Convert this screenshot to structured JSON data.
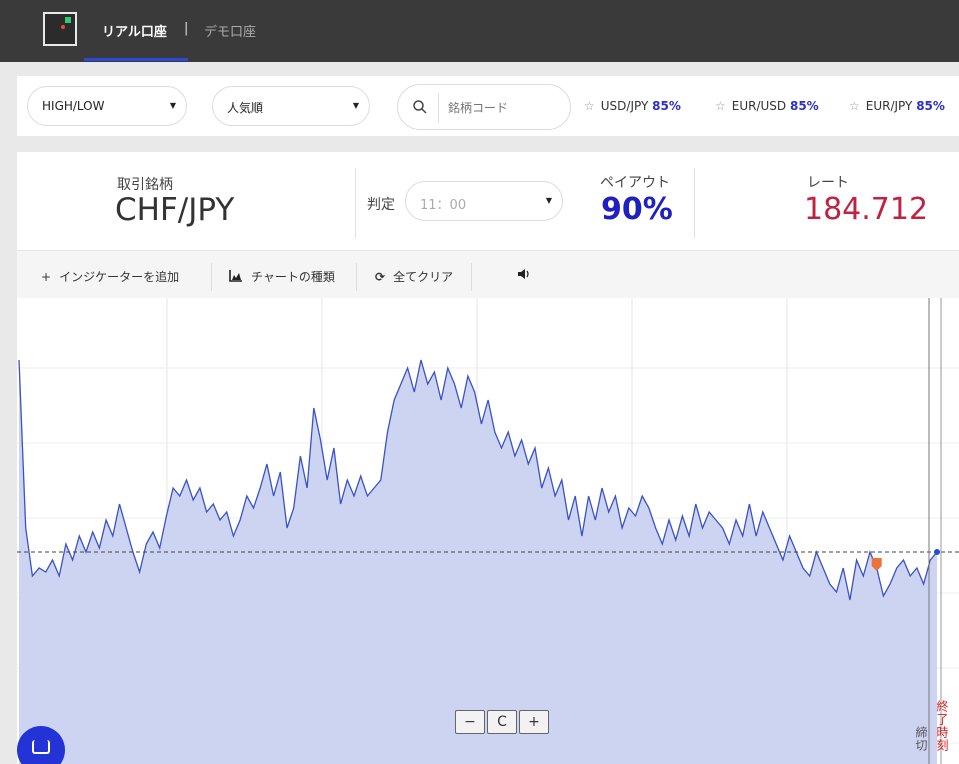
{
  "header": {
    "logo_icon": "app-logo-icon",
    "tabs": [
      {
        "label": "リアル口座",
        "active": true
      },
      {
        "label": "デモ口座",
        "active": false
      }
    ],
    "separator": "|",
    "accent_color": "#2a4bd8"
  },
  "filters": {
    "type_select": "HIGH/LOW",
    "sort_select": "人気順",
    "search_placeholder": "銘柄コード",
    "favorites": [
      {
        "pair": "USD/JPY",
        "payout": "85%"
      },
      {
        "pair": "EUR/USD",
        "payout": "85%"
      },
      {
        "pair": "EUR/JPY",
        "payout": "85%"
      }
    ]
  },
  "info": {
    "pair_label": "取引銘柄",
    "pair_value": "CHF/JPY",
    "judge_label": "判定",
    "judge_value": "11：00",
    "payout_label": "ペイアウト",
    "payout_value": "90%",
    "rate_label": "レート",
    "rate_value": "184.712",
    "payout_color": "#2020c0",
    "rate_color": "#c0233f"
  },
  "toolbar": {
    "add_indicator": "インジケーターを追加",
    "chart_type": "チャートの種類",
    "clear_all": "全てクリア",
    "sound_icon": "speaker-icon"
  },
  "chart": {
    "zoom_out": "−",
    "zoom_reset": "C",
    "zoom_in": "+",
    "close_label": "締切",
    "end_label": "終了時刻",
    "line_color": "#3a52c4",
    "fill_color": "#ccd4f2"
  },
  "chart_data": {
    "type": "area",
    "title": "",
    "xlabel": "",
    "ylabel": "",
    "current_rate_line": true,
    "series": [
      {
        "values": [
          0.92,
          0.5,
          0.38,
          0.4,
          0.39,
          0.42,
          0.38,
          0.46,
          0.42,
          0.48,
          0.44,
          0.49,
          0.45,
          0.52,
          0.48,
          0.56,
          0.5,
          0.44,
          0.39,
          0.46,
          0.49,
          0.45,
          0.53,
          0.6,
          0.58,
          0.62,
          0.57,
          0.6,
          0.54,
          0.56,
          0.52,
          0.54,
          0.48,
          0.52,
          0.58,
          0.55,
          0.6,
          0.66,
          0.58,
          0.64,
          0.5,
          0.55,
          0.68,
          0.6,
          0.8,
          0.72,
          0.62,
          0.7,
          0.56,
          0.62,
          0.58,
          0.63,
          0.58,
          0.6,
          0.62,
          0.74,
          0.82,
          0.86,
          0.9,
          0.84,
          0.92,
          0.86,
          0.89,
          0.82,
          0.9,
          0.86,
          0.8,
          0.88,
          0.84,
          0.76,
          0.82,
          0.74,
          0.7,
          0.74,
          0.68,
          0.72,
          0.66,
          0.7,
          0.6,
          0.65,
          0.58,
          0.62,
          0.52,
          0.58,
          0.48,
          0.58,
          0.52,
          0.6,
          0.54,
          0.58,
          0.5,
          0.55,
          0.53,
          0.58,
          0.55,
          0.5,
          0.46,
          0.52,
          0.47,
          0.53,
          0.48,
          0.56,
          0.5,
          0.54,
          0.52,
          0.5,
          0.46,
          0.52,
          0.48,
          0.56,
          0.48,
          0.54,
          0.5,
          0.46,
          0.42,
          0.48,
          0.44,
          0.4,
          0.38,
          0.44,
          0.4,
          0.36,
          0.34,
          0.4,
          0.32,
          0.42,
          0.38,
          0.44,
          0.4,
          0.33,
          0.36,
          0.4,
          0.42,
          0.38,
          0.4,
          0.36,
          0.42,
          0.44
        ],
        "unit": "relative level"
      }
    ]
  }
}
